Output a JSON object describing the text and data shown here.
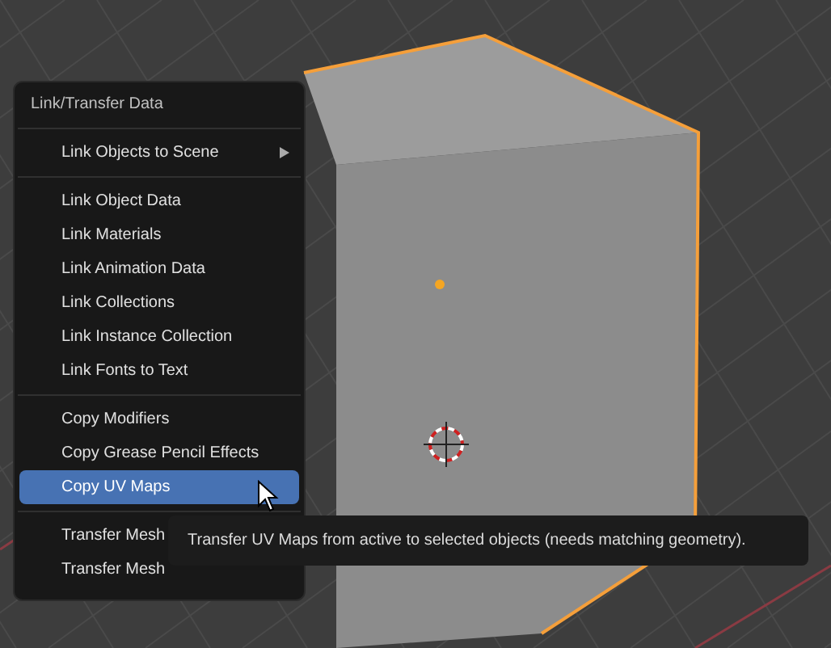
{
  "menu": {
    "title": "Link/Transfer Data",
    "groups": [
      {
        "items": [
          {
            "label": "Link Objects to Scene",
            "submenu": true,
            "selected": false
          }
        ]
      },
      {
        "items": [
          {
            "label": "Link Object Data",
            "submenu": false,
            "selected": false
          },
          {
            "label": "Link Materials",
            "submenu": false,
            "selected": false
          },
          {
            "label": "Link Animation Data",
            "submenu": false,
            "selected": false
          },
          {
            "label": "Link Collections",
            "submenu": false,
            "selected": false
          },
          {
            "label": "Link Instance Collection",
            "submenu": false,
            "selected": false
          },
          {
            "label": "Link Fonts to Text",
            "submenu": false,
            "selected": false
          }
        ]
      },
      {
        "items": [
          {
            "label": "Copy Modifiers",
            "submenu": false,
            "selected": false
          },
          {
            "label": "Copy Grease Pencil Effects",
            "submenu": false,
            "selected": false
          },
          {
            "label": "Copy UV Maps",
            "submenu": false,
            "selected": true
          }
        ]
      },
      {
        "items": [
          {
            "label": "Transfer Mesh",
            "submenu": false,
            "selected": false
          },
          {
            "label": "Transfer Mesh",
            "submenu": false,
            "selected": false
          }
        ]
      }
    ]
  },
  "tooltip": {
    "text": "Transfer UV Maps from active to selected objects (needs matching geometry)."
  }
}
